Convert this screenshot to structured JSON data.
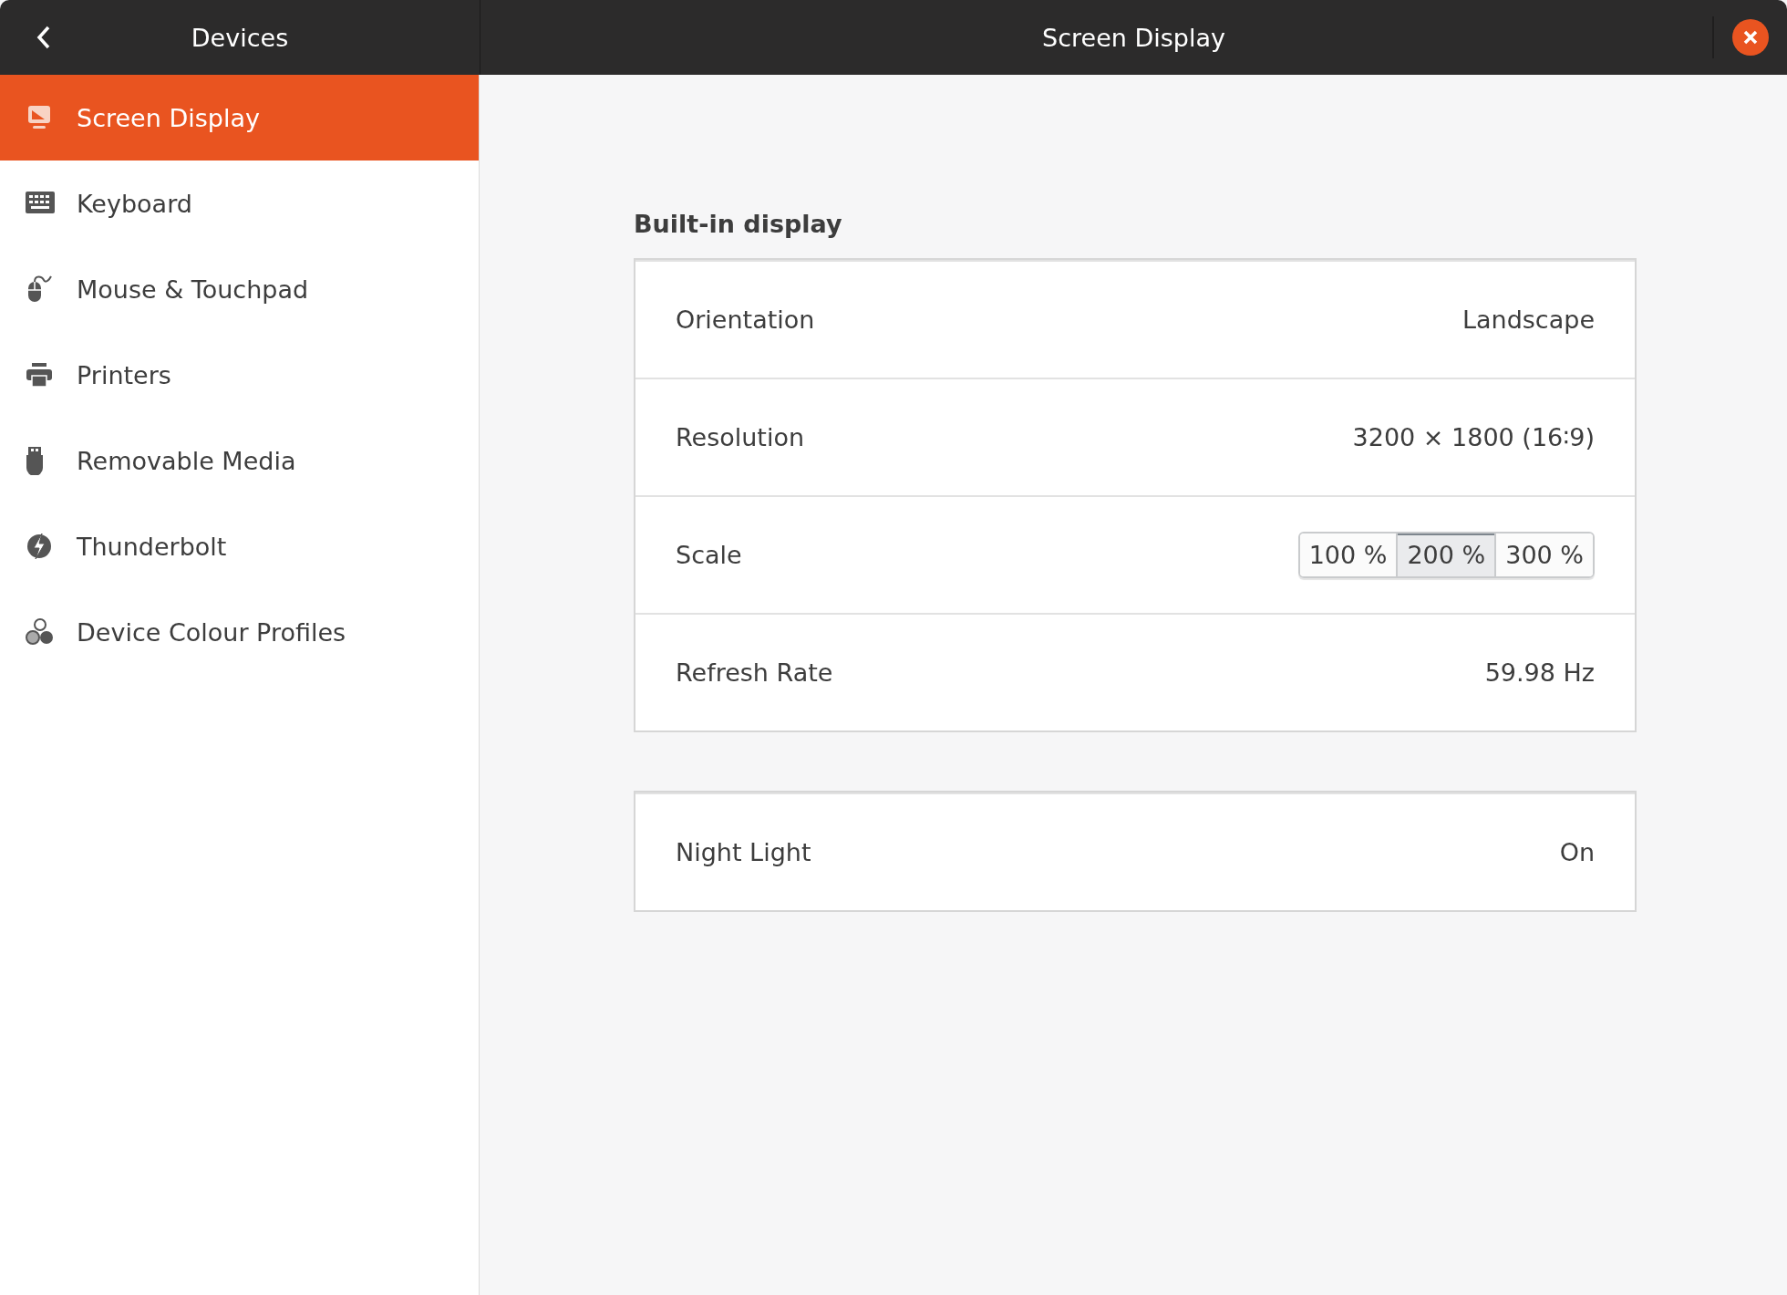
{
  "header": {
    "sidebar_title": "Devices",
    "title": "Screen Display"
  },
  "sidebar": {
    "items": [
      {
        "label": "Screen Display",
        "selected": true
      },
      {
        "label": "Keyboard",
        "selected": false
      },
      {
        "label": "Mouse & Touchpad",
        "selected": false
      },
      {
        "label": "Printers",
        "selected": false
      },
      {
        "label": "Removable Media",
        "selected": false
      },
      {
        "label": "Thunderbolt",
        "selected": false
      },
      {
        "label": "Device Colour Profiles",
        "selected": false
      }
    ]
  },
  "section_title": "Built-in display",
  "display_rows": [
    {
      "kind": "value",
      "label": "Orientation",
      "value": "Landscape"
    },
    {
      "kind": "value",
      "label": "Resolution",
      "value": "3200 × 1800 (16∶9)"
    },
    {
      "kind": "scale",
      "label": "Scale",
      "options": [
        {
          "label": "100 %",
          "selected": false
        },
        {
          "label": "200 %",
          "selected": true
        },
        {
          "label": "300 %",
          "selected": false
        }
      ]
    },
    {
      "kind": "value",
      "label": "Refresh Rate",
      "value": "59.98 Hz"
    }
  ],
  "night_light_rows": [
    {
      "kind": "value",
      "label": "Night Light",
      "value": "On"
    }
  ]
}
